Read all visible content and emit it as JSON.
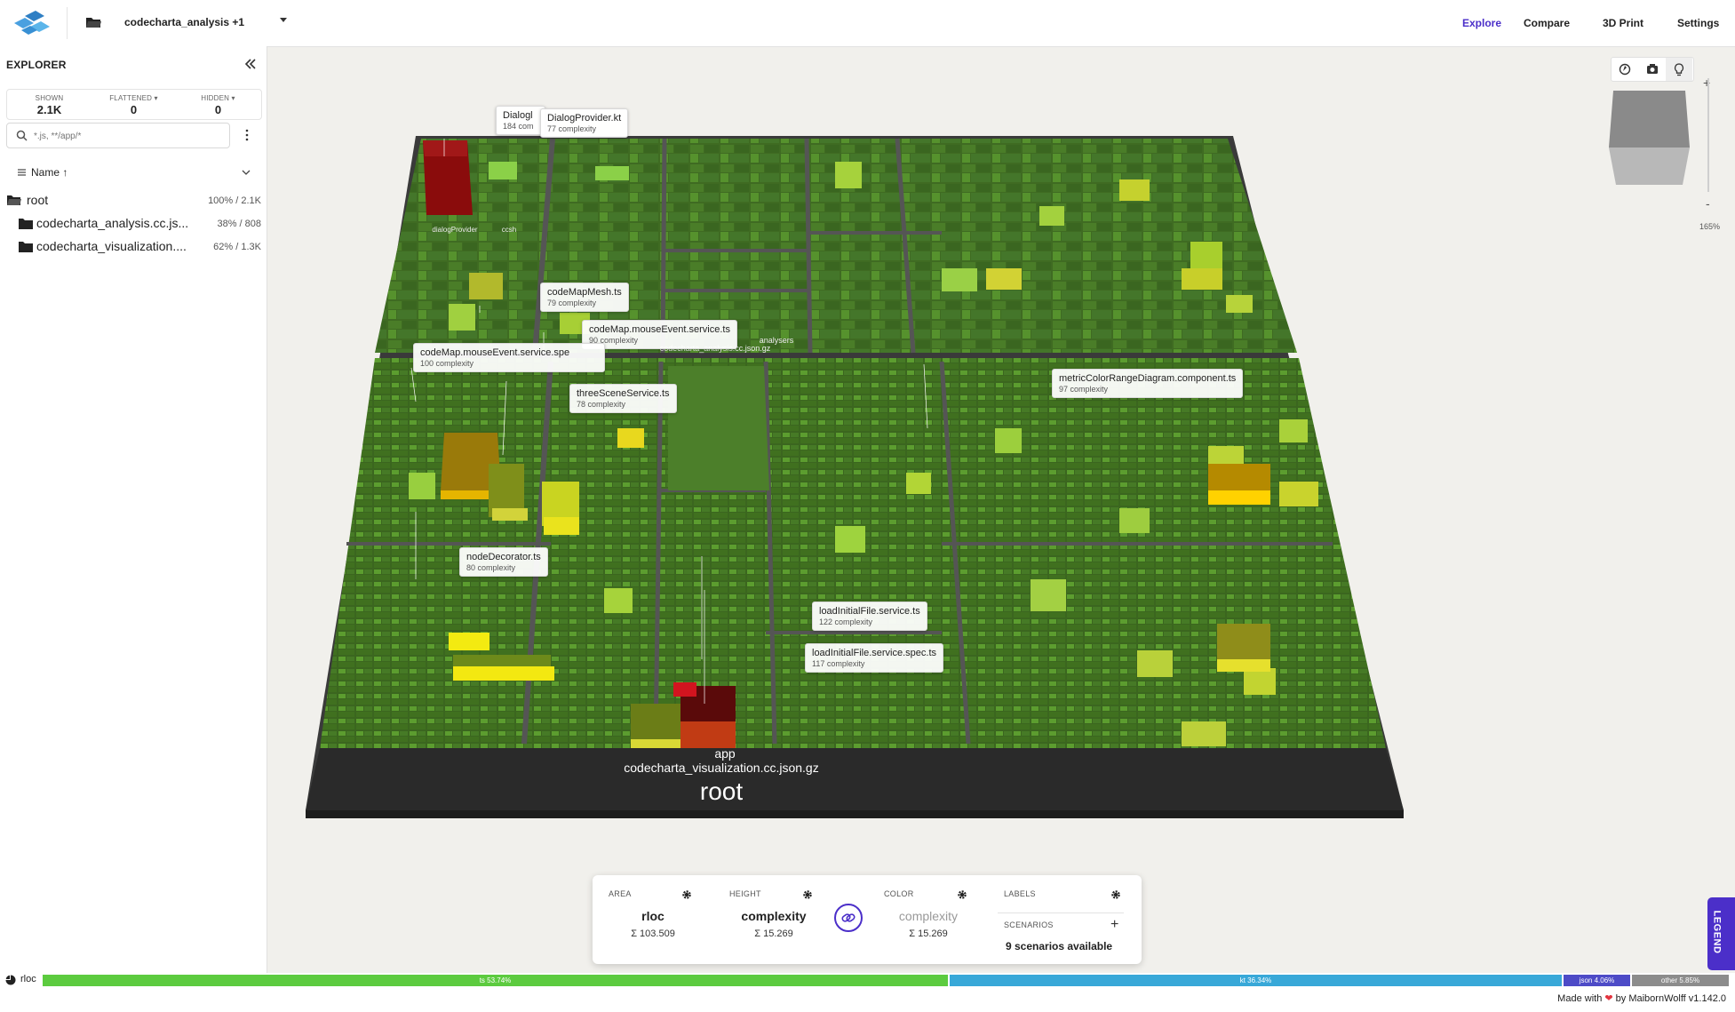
{
  "topbar": {
    "file_selector": "codecharta_analysis +1",
    "nav": [
      "Explore",
      "Compare",
      "3D Print",
      "Settings"
    ],
    "active_nav": "Explore",
    "accent": "#4b2fc9"
  },
  "sidebar": {
    "title": "EXPLORER",
    "counts": {
      "shown_label": "SHOWN",
      "shown_value": "2.1K",
      "flattened_label": "FLATTENED",
      "flattened_value": "0",
      "hidden_label": "HIDDEN",
      "hidden_value": "0"
    },
    "search_placeholder": "*.js, **/app/*",
    "sort_label": "Name",
    "tree": [
      {
        "name": "root",
        "meta": "100% / 2.1K",
        "icon": "folder-open-icon"
      },
      {
        "name": "codecharta_analysis.cc.js...",
        "meta": "38% / 808",
        "icon": "folder-icon"
      },
      {
        "name": "codecharta_visualization....",
        "meta": "62% / 1.3K",
        "icon": "folder-icon"
      }
    ]
  },
  "map": {
    "labels": {
      "root": "root",
      "visualization": "codecharta_visualization.cc.json.gz",
      "app": "app",
      "analysis": "codecharta_analysis.cc.json.gz",
      "analysers": "analysers",
      "dialog_provider": "dialogProvider",
      "ccsh": "ccsh"
    },
    "tooltips": [
      {
        "name": "Dialogl",
        "value": "184 com"
      },
      {
        "name": "DialogProvider.kt",
        "value": "77 complexity"
      },
      {
        "name": "codeMapMesh.ts",
        "value": "79 complexity"
      },
      {
        "name": "codeMap.mouseEvent.service.ts",
        "value": "90 complexity"
      },
      {
        "name": "codeMap.mouseEvent.service.spe",
        "value": "100 complexity"
      },
      {
        "name": "threeSceneService.ts",
        "value": "78 complexity"
      },
      {
        "name": "metricColorRangeDiagram.component.ts",
        "value": "97 complexity"
      },
      {
        "name": "nodeDecorator.ts",
        "value": "80 complexity"
      },
      {
        "name": "loadInitialFile.service.ts",
        "value": "122 complexity"
      },
      {
        "name": "loadInitialFile.service.spec.ts",
        "value": "117 complexity"
      }
    ],
    "zoom": "165%"
  },
  "metrics": {
    "area": {
      "label": "AREA",
      "metric": "rloc",
      "sum": "Σ 103.509"
    },
    "height": {
      "label": "HEIGHT",
      "metric": "complexity",
      "sum": "Σ 15.269"
    },
    "color": {
      "label": "COLOR",
      "metric": "complexity",
      "sum": "Σ 15.269"
    },
    "labels_label": "LABELS",
    "scenarios_label": "SCENARIOS",
    "scenarios_text": "9 scenarios available"
  },
  "legend_tab": "LEGEND",
  "bottom": {
    "metric": "rloc",
    "languages": [
      {
        "label": "ts 53.74%",
        "share": 53.74,
        "color": "#5ccb3f"
      },
      {
        "label": "kt 36.34%",
        "share": 36.34,
        "color": "#38a8d8"
      },
      {
        "label": "json 4.06%",
        "share": 4.06,
        "color": "#4d4bc7"
      },
      {
        "label": "other 5.85%",
        "share": 5.85,
        "color": "#8c8c8c"
      }
    ],
    "made_with_prefix": "Made with",
    "made_with_suffix": "by MaibornWolff v1.142.0"
  }
}
